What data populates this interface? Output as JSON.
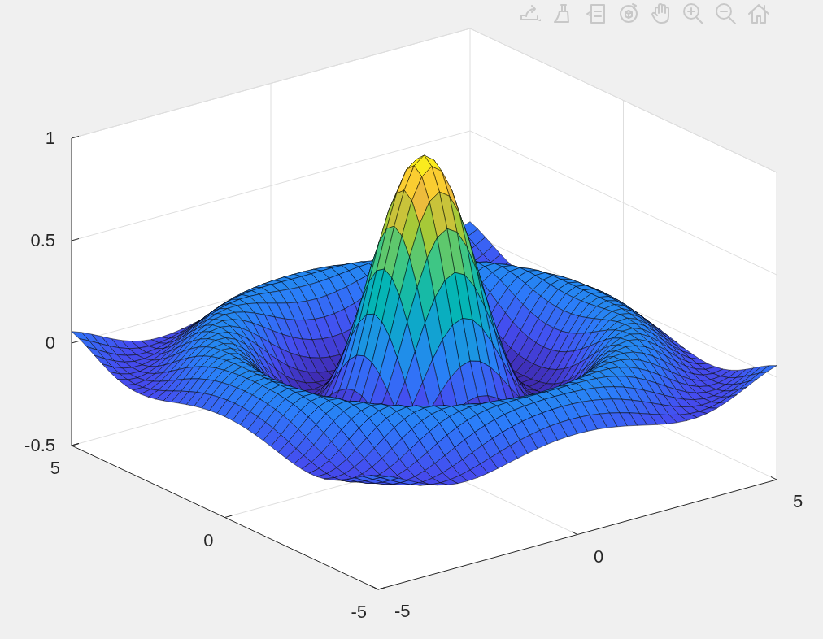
{
  "axes": {
    "z_ticks": [
      "1",
      "0.5",
      "0",
      "-0.5"
    ],
    "y_ticks": [
      "5",
      "0",
      "-5"
    ],
    "x_ticks": [
      "-5",
      "0",
      "5"
    ]
  }
}
